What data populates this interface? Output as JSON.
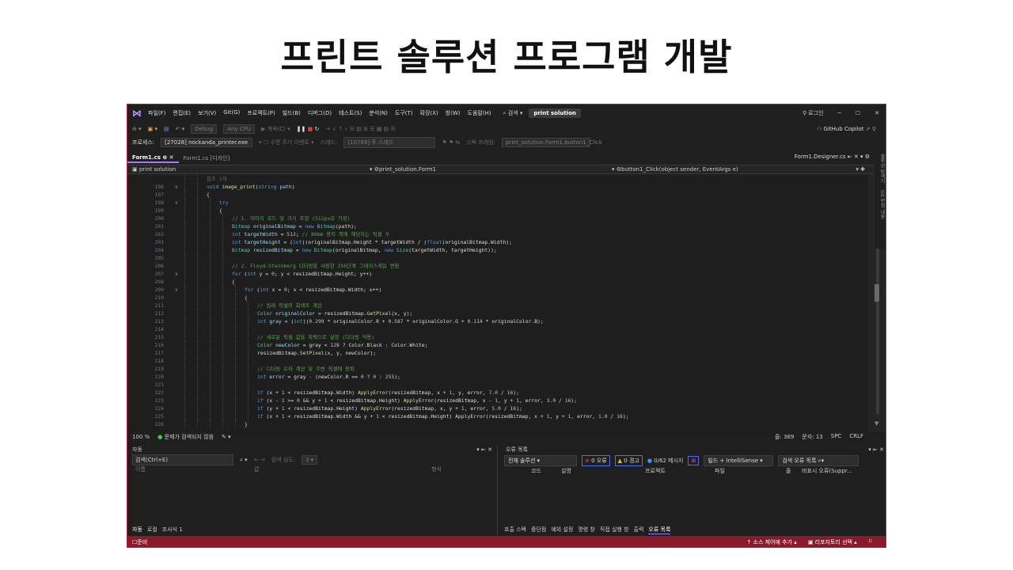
{
  "slide_title": "프린트 솔루션 프로그램 개발",
  "menubar": {
    "items": [
      "파일(F)",
      "편집(E)",
      "보기(V)",
      "Git(G)",
      "프로젝트(P)",
      "빌드(B)",
      "디버그(D)",
      "테스트(S)",
      "분석(N)",
      "도구(T)",
      "확장(X)",
      "창(W)",
      "도움말(H)"
    ],
    "search": "검색",
    "solution": "print solution",
    "login": "로그인"
  },
  "toolbar": {
    "config": "Debug",
    "platform": "Any CPU",
    "run": "계속(C)",
    "copilot": "GitHub Copilot"
  },
  "process_bar": {
    "label": "프로세스:",
    "value": "[27028] nockanda_printer.exe",
    "lifecycle": "수명 주기 이벤트",
    "thread_label": "스레드:",
    "thread": "[10788] 주 스레드",
    "stack_label": "스택 프레임:",
    "stack": "print_solution.Form1.button1_Click"
  },
  "tabs": {
    "active": "Form1.cs",
    "second": "Form1.cs [디자인]",
    "right": "Form1.Designer.cs"
  },
  "navbar": {
    "project": "print solution",
    "class": "print_solution.Form1",
    "member": "button1_Click(object sender, EventArgs e)"
  },
  "code": [
    {
      "n": "",
      "f": "",
      "t": [
        [
          "참조 1개",
          "dim"
        ]
      ],
      "i": 0
    },
    {
      "n": "196",
      "f": "∨",
      "t": [
        [
          "void ",
          "kw"
        ],
        [
          "image_print",
          "fn"
        ],
        [
          "(",
          "plain"
        ],
        [
          "string ",
          "kw"
        ],
        [
          "path",
          "var"
        ],
        [
          ")",
          "plain"
        ]
      ],
      "i": 0
    },
    {
      "n": "197",
      "f": "",
      "t": [
        [
          "{",
          "plain"
        ]
      ],
      "i": 0
    },
    {
      "n": "198",
      "f": "∨",
      "t": [
        [
          "try",
          "kw"
        ]
      ],
      "i": 1
    },
    {
      "n": "199",
      "f": "",
      "t": [
        [
          "{",
          "plain"
        ]
      ],
      "i": 1
    },
    {
      "n": "200",
      "f": "",
      "t": [
        [
          "// 1. 이미지 로드 및 크기 조정 (512px로 가정)",
          "cm"
        ]
      ],
      "i": 2
    },
    {
      "n": "201",
      "f": "",
      "t": [
        [
          "Bitmap ",
          "ty"
        ],
        [
          "originalBitmap",
          "var"
        ],
        [
          " = ",
          "plain"
        ],
        [
          "new ",
          "kw"
        ],
        [
          "Bitmap",
          "ty"
        ],
        [
          "(path);",
          "plain"
        ]
      ],
      "i": 2
    },
    {
      "n": "202",
      "f": "",
      "t": [
        [
          "int ",
          "kw"
        ],
        [
          "targetWidth",
          "var"
        ],
        [
          " = ",
          "plain"
        ],
        [
          "512",
          "num"
        ],
        [
          "; ",
          "plain"
        ],
        [
          "// 80mm 용지 폭에 해당하는 픽셀 수",
          "cm"
        ]
      ],
      "i": 2
    },
    {
      "n": "203",
      "f": "",
      "t": [
        [
          "int ",
          "kw"
        ],
        [
          "targetHeight",
          "var"
        ],
        [
          " = (",
          "plain"
        ],
        [
          "int",
          "kw"
        ],
        [
          ")(originalBitmap.Height * targetWidth / (",
          "plain"
        ],
        [
          "float",
          "kw"
        ],
        [
          ")originalBitmap.Width);",
          "plain"
        ]
      ],
      "i": 2
    },
    {
      "n": "204",
      "f": "",
      "t": [
        [
          "Bitmap ",
          "ty"
        ],
        [
          "resizedBitmap",
          "var"
        ],
        [
          " = ",
          "plain"
        ],
        [
          "new ",
          "kw"
        ],
        [
          "Bitmap",
          "ty"
        ],
        [
          "(originalBitmap, ",
          "plain"
        ],
        [
          "new ",
          "kw"
        ],
        [
          "Size",
          "ty"
        ],
        [
          "(targetWidth, targetHeight));",
          "plain"
        ]
      ],
      "i": 2
    },
    {
      "n": "205",
      "f": "",
      "t": [],
      "i": 2
    },
    {
      "n": "206",
      "f": "",
      "t": [
        [
          "// 2. Floyd-Steinberg 디더링을 사용한 256단계 그레이스케일 변환",
          "cm"
        ]
      ],
      "i": 2
    },
    {
      "n": "207",
      "f": "∨",
      "t": [
        [
          "for ",
          "kw"
        ],
        [
          "(",
          "plain"
        ],
        [
          "int ",
          "kw"
        ],
        [
          "y = ",
          "plain"
        ],
        [
          "0",
          "num"
        ],
        [
          "; y < resizedBitmap.Height; y++)",
          "plain"
        ]
      ],
      "i": 2
    },
    {
      "n": "208",
      "f": "",
      "t": [
        [
          "{",
          "plain"
        ]
      ],
      "i": 2
    },
    {
      "n": "209",
      "f": "∨",
      "t": [
        [
          "for ",
          "kw"
        ],
        [
          "(",
          "plain"
        ],
        [
          "int ",
          "kw"
        ],
        [
          "x = ",
          "plain"
        ],
        [
          "0",
          "num"
        ],
        [
          "; x < resizedBitmap.Width; x++)",
          "plain"
        ]
      ],
      "i": 3
    },
    {
      "n": "210",
      "f": "",
      "t": [
        [
          "{",
          "plain"
        ]
      ],
      "i": 3
    },
    {
      "n": "211",
      "f": "",
      "t": [
        [
          "// 원래 픽셀의 회색조 계산",
          "cm"
        ]
      ],
      "i": 4
    },
    {
      "n": "212",
      "f": "",
      "t": [
        [
          "Color ",
          "ty"
        ],
        [
          "originalColor",
          "var"
        ],
        [
          " = resizedBitmap.",
          "plain"
        ],
        [
          "GetPixel",
          "fn"
        ],
        [
          "(x, y);",
          "plain"
        ]
      ],
      "i": 4
    },
    {
      "n": "213",
      "f": "",
      "t": [
        [
          "int ",
          "kw"
        ],
        [
          "gray",
          "var"
        ],
        [
          " = (",
          "plain"
        ],
        [
          "int",
          "kw"
        ],
        [
          ")(",
          "plain"
        ],
        [
          "0.299",
          "num"
        ],
        [
          " * originalColor.R + ",
          "plain"
        ],
        [
          "0.587",
          "num"
        ],
        [
          " * originalColor.G + ",
          "plain"
        ],
        [
          "0.114",
          "num"
        ],
        [
          " * originalColor.B);",
          "plain"
        ]
      ],
      "i": 4
    },
    {
      "n": "214",
      "f": "",
      "t": [],
      "i": 4
    },
    {
      "n": "215",
      "f": "",
      "t": [
        [
          "// 새로운 픽셀 값을 흑백으로 설정 (디더링 적용)",
          "cm"
        ]
      ],
      "i": 4
    },
    {
      "n": "216",
      "f": "",
      "t": [
        [
          "Color ",
          "ty"
        ],
        [
          "newColor",
          "var"
        ],
        [
          " = gray < ",
          "plain"
        ],
        [
          "128",
          "num"
        ],
        [
          " ? Color.Black : Color.White;",
          "plain"
        ]
      ],
      "i": 4
    },
    {
      "n": "217",
      "f": "",
      "t": [
        [
          "resizedBitmap.",
          "plain"
        ],
        [
          "SetPixel",
          "fn"
        ],
        [
          "(x, y, newColor);",
          "plain"
        ]
      ],
      "i": 4
    },
    {
      "n": "218",
      "f": "",
      "t": [],
      "i": 4
    },
    {
      "n": "219",
      "f": "",
      "t": [
        [
          "// 디더링 오차 계산 및 주변 픽셀에 전파",
          "cm"
        ]
      ],
      "i": 4
    },
    {
      "n": "220",
      "f": "",
      "t": [
        [
          "int ",
          "kw"
        ],
        [
          "error",
          "var"
        ],
        [
          " = gray - (newColor.R == ",
          "plain"
        ],
        [
          "0",
          "num"
        ],
        [
          " ? ",
          "plain"
        ],
        [
          "0",
          "num"
        ],
        [
          " : ",
          "plain"
        ],
        [
          "255",
          "num"
        ],
        [
          ");",
          "plain"
        ]
      ],
      "i": 4
    },
    {
      "n": "221",
      "f": "",
      "t": [],
      "i": 4
    },
    {
      "n": "222",
      "f": "",
      "t": [
        [
          "if ",
          "kw"
        ],
        [
          "(x + ",
          "plain"
        ],
        [
          "1",
          "num"
        ],
        [
          " < resizedBitmap.Width) ",
          "plain"
        ],
        [
          "ApplyError",
          "fn"
        ],
        [
          "(resizedBitmap, x + ",
          "plain"
        ],
        [
          "1",
          "num"
        ],
        [
          ", y, error, ",
          "plain"
        ],
        [
          "7.0",
          "num"
        ],
        [
          " / ",
          "plain"
        ],
        [
          "16",
          "num"
        ],
        [
          ");",
          "plain"
        ]
      ],
      "i": 4
    },
    {
      "n": "223",
      "f": "",
      "t": [
        [
          "if ",
          "kw"
        ],
        [
          "(x - ",
          "plain"
        ],
        [
          "1",
          "num"
        ],
        [
          " >= ",
          "plain"
        ],
        [
          "0",
          "num"
        ],
        [
          " && y + ",
          "plain"
        ],
        [
          "1",
          "num"
        ],
        [
          " < resizedBitmap.Height) ",
          "plain"
        ],
        [
          "ApplyError",
          "fn"
        ],
        [
          "(resizedBitmap, x - ",
          "plain"
        ],
        [
          "1",
          "num"
        ],
        [
          ", y + ",
          "plain"
        ],
        [
          "1",
          "num"
        ],
        [
          ", error, ",
          "plain"
        ],
        [
          "3.0",
          "num"
        ],
        [
          " / ",
          "plain"
        ],
        [
          "16",
          "num"
        ],
        [
          ");",
          "plain"
        ]
      ],
      "i": 4
    },
    {
      "n": "224",
      "f": "",
      "t": [
        [
          "if ",
          "kw"
        ],
        [
          "(y + ",
          "plain"
        ],
        [
          "1",
          "num"
        ],
        [
          " < resizedBitmap.Height) ",
          "plain"
        ],
        [
          "ApplyError",
          "fn"
        ],
        [
          "(resizedBitmap, x, y + ",
          "plain"
        ],
        [
          "1",
          "num"
        ],
        [
          ", error, ",
          "plain"
        ],
        [
          "5.0",
          "num"
        ],
        [
          " / ",
          "plain"
        ],
        [
          "16",
          "num"
        ],
        [
          ");",
          "plain"
        ]
      ],
      "i": 4
    },
    {
      "n": "225",
      "f": "",
      "t": [
        [
          "if ",
          "kw"
        ],
        [
          "(x + ",
          "plain"
        ],
        [
          "1",
          "num"
        ],
        [
          " < resizedBitmap.Width && y + ",
          "plain"
        ],
        [
          "1",
          "num"
        ],
        [
          " < resizedBitmap.Height) ",
          "plain"
        ],
        [
          "ApplyError",
          "fn"
        ],
        [
          "(resizedBitmap, x + ",
          "plain"
        ],
        [
          "1",
          "num"
        ],
        [
          ", y + ",
          "plain"
        ],
        [
          "1",
          "num"
        ],
        [
          ", error, ",
          "plain"
        ],
        [
          "1.0",
          "num"
        ],
        [
          " / ",
          "plain"
        ],
        [
          "16",
          "num"
        ],
        [
          ");",
          "plain"
        ]
      ],
      "i": 4
    },
    {
      "n": "226",
      "f": "",
      "t": [
        [
          "}",
          "plain"
        ]
      ],
      "i": 3
    }
  ],
  "statusline": {
    "zoom": "100 %",
    "issues": "문제가 검색되지 않음",
    "line": "줄: 369",
    "col": "문자: 13",
    "spc": "SPC",
    "crlf": "CRLF"
  },
  "autos": {
    "title": "자동",
    "search_placeholder": "검색(Ctrl+E)",
    "depth_label": "검색 심도:",
    "depth": "3",
    "col_name": "이름",
    "col_value": "값",
    "col_type": "형식",
    "tabs": [
      "자동",
      "로컬",
      "조사식 1"
    ]
  },
  "errors": {
    "title": "오류 목록",
    "scope": "전체 솔루션",
    "err": "0 오류",
    "warn": "0 경고",
    "msg": "0/62 메시지",
    "build": "빌드 + IntelliSense",
    "search": "검색 오류 목록",
    "cols": [
      "코드",
      "설명",
      "프로젝트",
      "파일",
      "줄",
      "비표시 오류(Suppr..."
    ],
    "tabs": [
      "호출 스택",
      "중단점",
      "예외 설정",
      "명령 창",
      "직접 실행 창",
      "출력",
      "오류 목록"
    ]
  },
  "bottom_status": {
    "ready": "준비",
    "source_control": "소스 제어에 추가",
    "repo": "리포지토리 선택"
  },
  "right_rail": {
    "explorer": "솔루션 탐색기",
    "git": "Git 변경 내용"
  },
  "colors": {
    "accent": "#a37bff",
    "status_bar": "#8a1a2a",
    "comment": "#57a64a",
    "keyword": "#569cd6"
  }
}
